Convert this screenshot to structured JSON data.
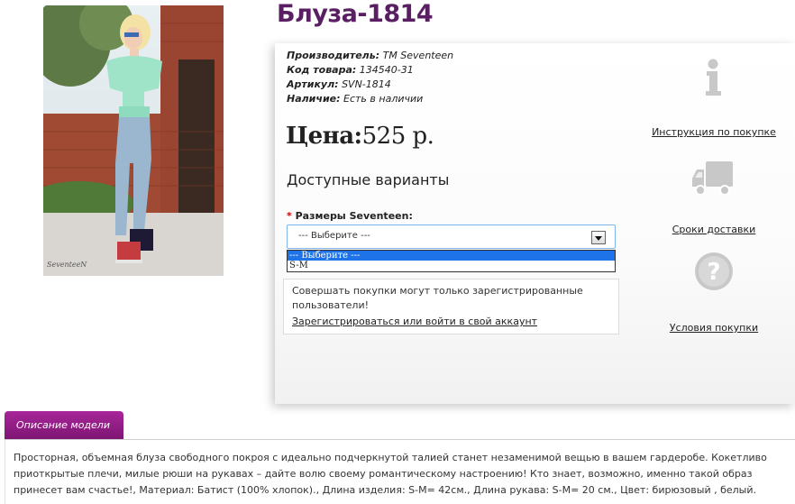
{
  "product": {
    "title": "Блуза-1814",
    "photo_signature": "SeventeeN"
  },
  "meta": {
    "manufacturer_label": "Производитель:",
    "manufacturer_value": "TM Seventeen",
    "code_label": "Код товара:",
    "code_value": "134540-31",
    "sku_label": "Артикул:",
    "sku_value": "SVN-1814",
    "stock_label": "Наличие:",
    "stock_value": "Есть в наличии"
  },
  "price": {
    "label": "Цена:",
    "value": "525 р."
  },
  "variants": {
    "heading": "Доступные варианты",
    "required_mark": "*",
    "size_label": "Размеры Seventeen:",
    "select_value": "--- Выберите ---",
    "options": [
      "--- Выберите ---",
      "S-M"
    ]
  },
  "notice": {
    "line1": "Совершать покупки могут только зарегистрированные",
    "line2": "пользователи!",
    "link": "Зарегистрироваться или войти в свой аккаунт"
  },
  "sidebar": {
    "instruction": "Инструкция по покупке",
    "delivery": "Сроки доставки",
    "conditions": "Условия покупки"
  },
  "description": {
    "tab_label": "Описание модели",
    "text": "Просторная, объемная блуза свободного покроя с идеально подчеркнутой талией станет незаменимой вещью в вашем гардеробе. Кокетливо приоткрытые плечи, милые рюши на рукавах – дайте волю своему романтическому настроению! Кто знает, возможно, именно такой образ принесет вам счастье!, Материал: Батист (100% хлопок)., Длина изделия: S-M= 42см., Длина рукава: S-M= 20 см., Цвет: бирюзовый , белый."
  },
  "colors": {
    "title": "#5a1f63",
    "tab": "#8e1d82",
    "select_border": "#7eb4ea",
    "selected_option": "#1e73e8",
    "required": "#cc0000",
    "icon_gray": "#c8c8c8"
  }
}
